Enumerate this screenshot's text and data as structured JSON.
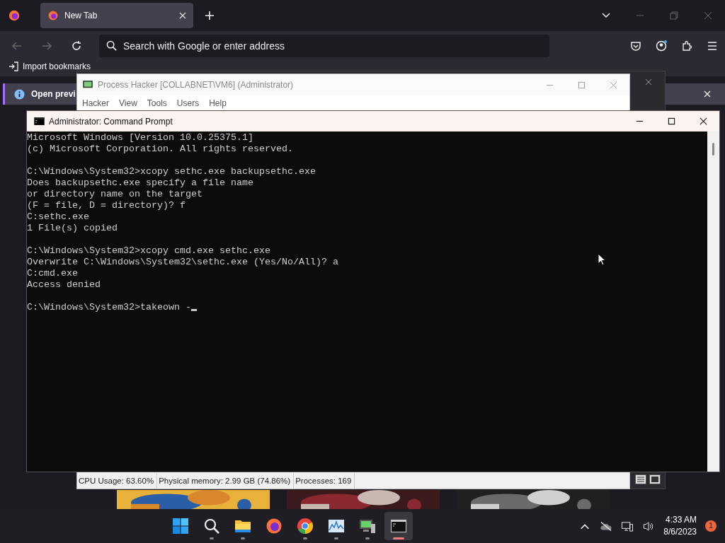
{
  "browser": {
    "tabs": [
      {
        "title": "New Tab",
        "selected": true
      }
    ],
    "search": {
      "placeholder": "Search with Google or enter address"
    },
    "bookmarks": [
      {
        "label": "Import bookmarks"
      }
    ],
    "notification": "Open previ"
  },
  "process_hacker": {
    "title": "Process Hacker [COLLABNET\\VM6] (Administrator)",
    "menu": [
      "Hacker",
      "View",
      "Tools",
      "Users",
      "Help"
    ],
    "status": [
      "CPU Usage: 63.60%",
      "Physical memory: 2.99 GB (74.86%)",
      "Processes: 169"
    ]
  },
  "cmd": {
    "title": "Administrator:  Command Prompt",
    "blocks": [
      [
        "Microsoft Windows [Version 10.0.25375.1]",
        "(c) Microsoft Corporation. All rights reserved."
      ],
      [
        "C:\\Windows\\System32>xcopy sethc.exe backupsethc.exe",
        "Does backupsethc.exe specify a file name",
        "or directory name on the target",
        "(F = file, D = directory)? f",
        "C:sethc.exe",
        "1 File(s) copied"
      ],
      [
        "C:\\Windows\\System32>xcopy cmd.exe sethc.exe",
        "Overwrite C:\\Windows\\System32\\sethc.exe (Yes/No/All)? a",
        "C:cmd.exe",
        "Access denied"
      ]
    ],
    "input": "C:\\Windows\\System32>takeown -"
  },
  "taskbar": {
    "apps": [
      {
        "kind": "start",
        "active": false
      },
      {
        "kind": "search",
        "active": false
      },
      {
        "kind": "folder",
        "active": false
      },
      {
        "kind": "firefox",
        "active": false
      },
      {
        "kind": "chrome",
        "active": false
      },
      {
        "kind": "monitor",
        "active": false
      },
      {
        "kind": "hacker",
        "active": false
      },
      {
        "kind": "terminal",
        "active": true
      }
    ],
    "time": "4:33 AM",
    "date": "8/6/2023",
    "badge": "1"
  }
}
